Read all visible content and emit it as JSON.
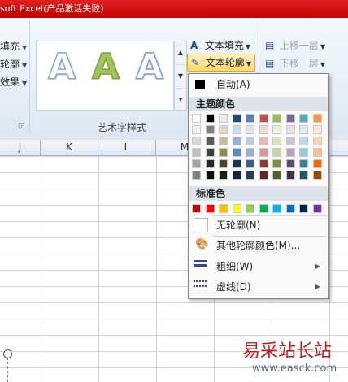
{
  "window": {
    "title": "soft Excel(产品激活失败)"
  },
  "ribbon": {
    "left_items": [
      {
        "label": "填充"
      },
      {
        "label": "轮廓"
      },
      {
        "label": "效果"
      }
    ],
    "group_label": "艺术字样式",
    "wordart_gallery": {
      "samples": [
        "A",
        "A",
        "A"
      ]
    },
    "text_fill_label": "文本填充",
    "text_outline_label": "文本轮廓",
    "bring_forward_label": "上移一层",
    "send_backward_label": "下移一层"
  },
  "columns": [
    "J",
    "K",
    "L",
    "M"
  ],
  "menu": {
    "auto_label": "自动(A)",
    "theme_header": "主题颜色",
    "standard_header": "标准色",
    "no_outline_label": "无轮廓(N)",
    "more_colors_label": "其他轮廓颜色(M)...",
    "weight_label": "粗细(W)",
    "dashes_label": "虚线(D)",
    "theme_colors": [
      [
        "#FFFFFF",
        "#000000",
        "#EEECE1",
        "#1F497D",
        "#4F81BD",
        "#C0504D",
        "#9BBB59",
        "#8064A2",
        "#4BACC6",
        "#F79646"
      ],
      [
        "#F2F2F2",
        "#7F7F7F",
        "#DDD9C3",
        "#C6D9F0",
        "#DBE5F1",
        "#F2DCDB",
        "#EBF1DD",
        "#E5E0EC",
        "#DBEEF3",
        "#FDEADA"
      ],
      [
        "#D8D8D8",
        "#595959",
        "#C4BD97",
        "#8DB3E2",
        "#B8CCE4",
        "#E5B9B7",
        "#D7E3BC",
        "#CCC1D9",
        "#B7DDE8",
        "#FBD5B5"
      ],
      [
        "#BFBFBF",
        "#3F3F3F",
        "#938953",
        "#548DD4",
        "#95B3D7",
        "#D99694",
        "#C3D69B",
        "#B2A2C7",
        "#92CDDC",
        "#FAC08F"
      ],
      [
        "#A5A5A5",
        "#262626",
        "#494429",
        "#17365D",
        "#366092",
        "#953734",
        "#76923C",
        "#5F497A",
        "#31859B",
        "#E36C09"
      ],
      [
        "#7F7F7F",
        "#0C0C0C",
        "#1D1B10",
        "#0F243E",
        "#244061",
        "#632423",
        "#4F6128",
        "#3F3151",
        "#205867",
        "#974806"
      ]
    ],
    "standard_colors": [
      "#C00000",
      "#FF0000",
      "#FFC000",
      "#FFFF00",
      "#92D050",
      "#00B050",
      "#00B0F0",
      "#0070C0",
      "#002060",
      "#7030A0"
    ]
  },
  "watermark": {
    "brand": "易采站长站",
    "url": "www.easck.com"
  }
}
